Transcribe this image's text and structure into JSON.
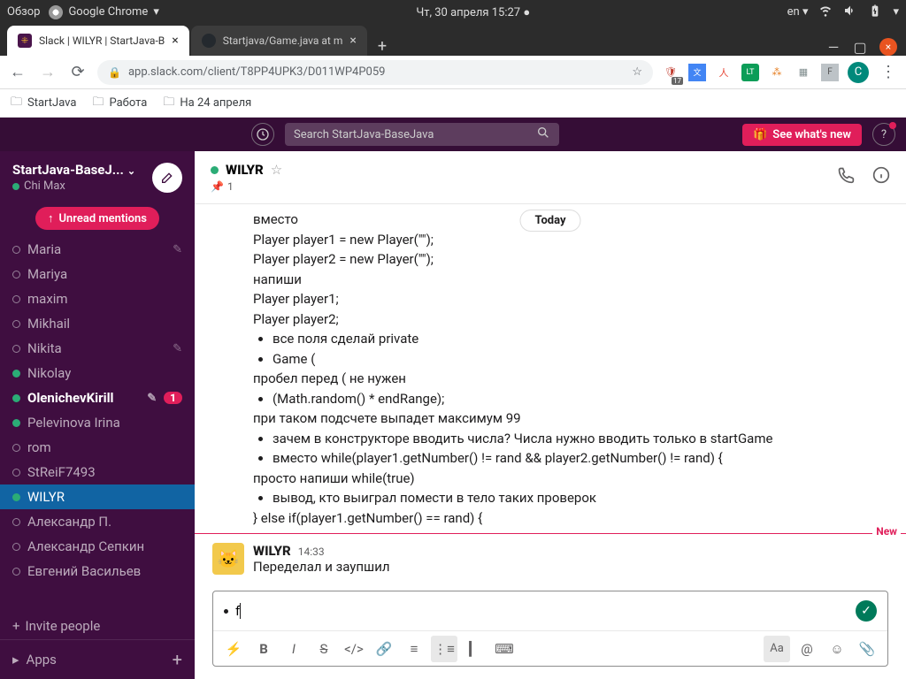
{
  "os": {
    "overview": "Обзор",
    "app": "Google Chrome",
    "datetime": "Чт, 30 апреля  15:27",
    "lang": "en"
  },
  "tabs": [
    {
      "title": "Slack | WILYR | StartJava-B",
      "active": true
    },
    {
      "title": "Startjava/Game.java at m",
      "active": false
    }
  ],
  "url": "app.slack.com/client/T8PP4UPK3/D011WP4P059",
  "avatar_letter": "С",
  "bookmarks": [
    "StartJava",
    "Работа",
    "На 24 апреля"
  ],
  "slack": {
    "search_placeholder": "Search StartJava-BaseJava",
    "whats_new": "See what's new",
    "workspace": "StartJava-BaseJ...",
    "user": "Chi Max",
    "unread_label": "Unread mentions",
    "members": [
      {
        "name": "Maria",
        "status": "away",
        "edit": true
      },
      {
        "name": "Mariya",
        "status": "away"
      },
      {
        "name": "maxim",
        "status": "away"
      },
      {
        "name": "Mikhail",
        "status": "away"
      },
      {
        "name": "Nikita",
        "status": "away",
        "edit": true
      },
      {
        "name": "Nikolay",
        "status": "online"
      },
      {
        "name": "OlenichevKirill",
        "status": "online",
        "bold": true,
        "edit": true,
        "badge": "1"
      },
      {
        "name": "Pelevinova Irina",
        "status": "online"
      },
      {
        "name": "rom",
        "status": "away"
      },
      {
        "name": "StReiF7493",
        "status": "away"
      },
      {
        "name": "WILYR",
        "status": "online",
        "active": true
      },
      {
        "name": "Александр П.",
        "status": "away"
      },
      {
        "name": "Александр Сепкин",
        "status": "away"
      },
      {
        "name": "Евгений Васильев",
        "status": "away"
      }
    ],
    "invite": "Invite people",
    "apps": "Apps",
    "channel": {
      "name": "WILYR",
      "pin_count": "1",
      "today": "Today",
      "new_label": "New",
      "lines_pre": [
        "вместо",
        "Player player1 = new Player(\"\");",
        "            Player player2 = new Player(\"\");",
        "напиши",
        "Player player1;",
        "Player player2;"
      ],
      "bullets1": [
        "все поля сделай private",
        "Game ("
      ],
      "line_mid1": "пробел перед ( не нужен",
      "bullets2": [
        "(Math.random() * endRange);"
      ],
      "line_mid2": "при таком подсчете выпадет максимум 99",
      "bullets3": [
        "зачем в конструкторе вводить числа? Числа нужно вводить только в startGame",
        "вместо while(player1.getNumber() != rand && player2.getNumber() != rand) {"
      ],
      "line_mid3": "просто напиши while(true)",
      "bullets4": [
        "вывод, кто выиграл помести в тело таких проверок"
      ],
      "line_end": "} else if(player1.getNumber() == rand) {",
      "msg2": {
        "author": "WILYR",
        "time": "14:33",
        "text": "Переделал и заупшил"
      },
      "compose_text": "f"
    }
  }
}
